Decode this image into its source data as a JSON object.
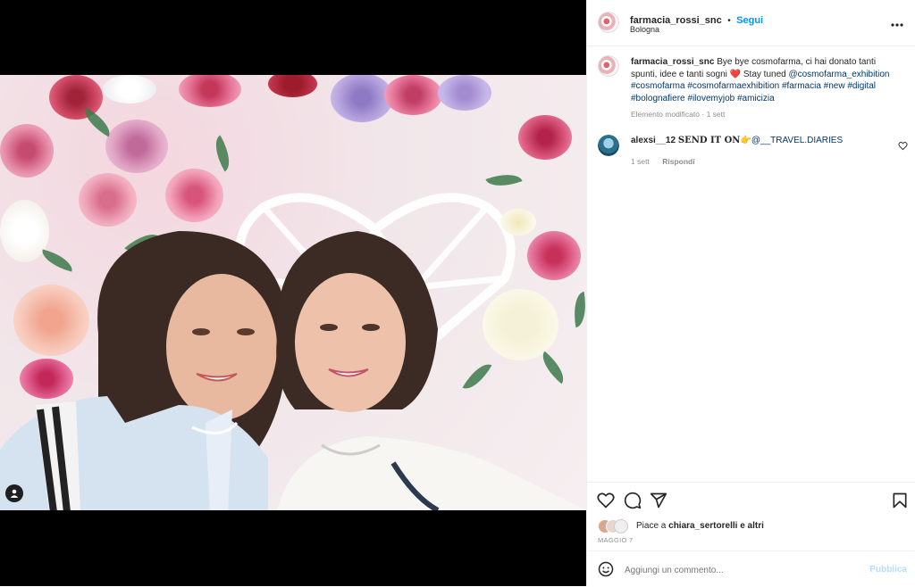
{
  "post": {
    "username": "farmacia_rossi_snc",
    "follow_label": "Segui",
    "separator": "•",
    "location": "Bologna"
  },
  "caption": {
    "username": "farmacia_rossi_snc",
    "text_1": "Bye bye cosmofarma, ci hai donato tanti spunti, idee e tanti sogni",
    "heart_emoji": "❤️",
    "text_2": "Stay tuned",
    "mention": "@cosmofarma_exhibition",
    "hashtags": [
      "#cosmofarma",
      "#cosmofarmaexhibition",
      "#farmacia",
      "#new",
      "#digital",
      "#bolognafiere",
      "#ilovemyjob",
      "#amicizia"
    ],
    "meta": "Elemento modificato · 1 sett"
  },
  "comment": {
    "username": "alexsi__12",
    "text": "𝐒𝐄𝐍𝐃 𝐈𝐓 𝐎𝐍",
    "emoji": "👉",
    "mention": "@__TRAVEL.DIARIES",
    "time": "1 sett",
    "reply_label": "Rispondi"
  },
  "likes": {
    "prefix": "Piace a",
    "user": "chiara_sertorelli",
    "suffix": "e altri"
  },
  "date": "MAGGIO 7",
  "add_comment": {
    "placeholder": "Aggiungi un commento...",
    "publish_label": "Pubblica"
  },
  "colors": {
    "link": "#00376b",
    "follow": "#0095f6",
    "publish_disabled": "#b2dffc",
    "heart_red": "#ed4956"
  },
  "icons": [
    "person-tag-icon",
    "more-options-icon",
    "like-icon",
    "comment-icon",
    "share-icon",
    "save-icon",
    "emoji-icon",
    "comment-like-icon"
  ]
}
